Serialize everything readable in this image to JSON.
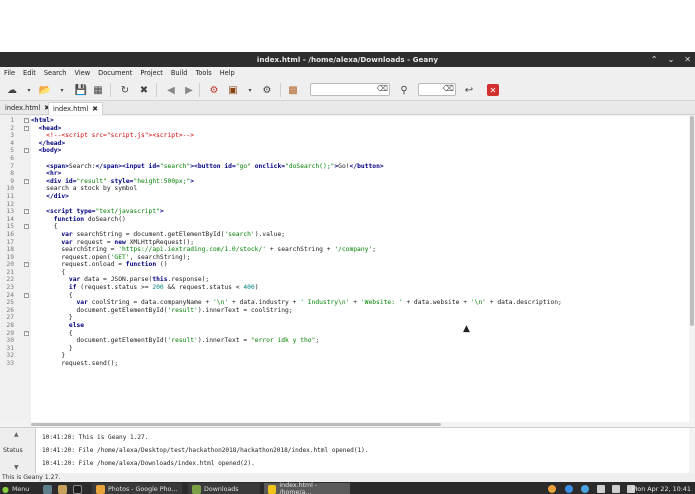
{
  "window": {
    "title": "index.html - /home/alexa/Downloads - Geany"
  },
  "menu": [
    "File",
    "Edit",
    "Search",
    "View",
    "Document",
    "Project",
    "Build",
    "Tools",
    "Help"
  ],
  "tabs": [
    {
      "label": "index.html",
      "active": false
    },
    {
      "label": "index.html",
      "active": true
    }
  ],
  "code_lines": [
    {
      "n": "1",
      "fold": "-",
      "parts": [
        [
          "tag",
          "<html>"
        ]
      ]
    },
    {
      "n": "2",
      "fold": "-",
      "parts": [
        [
          "plain",
          "  "
        ],
        [
          "tag",
          "<head>"
        ]
      ]
    },
    {
      "n": "3",
      "fold": "",
      "parts": [
        [
          "cmt",
          "    <!--<script src=\"script.js\"><script>-->"
        ]
      ]
    },
    {
      "n": "4",
      "fold": "",
      "parts": [
        [
          "plain",
          "  "
        ],
        [
          "tag",
          "</head>"
        ]
      ]
    },
    {
      "n": "5",
      "fold": "-",
      "parts": [
        [
          "plain",
          "  "
        ],
        [
          "tag",
          "<body>"
        ]
      ]
    },
    {
      "n": "6",
      "fold": "",
      "parts": []
    },
    {
      "n": "7",
      "fold": "",
      "parts": [
        [
          "plain",
          "    "
        ],
        [
          "tag",
          "<span>"
        ],
        [
          "plain",
          "Search:"
        ],
        [
          "tag",
          "</span><input id="
        ],
        [
          "str",
          "\"search\""
        ],
        [
          "tag",
          "><button id="
        ],
        [
          "str",
          "\"go\""
        ],
        [
          "tag",
          " onclick="
        ],
        [
          "str",
          "\"doSearch();\""
        ],
        [
          "tag",
          ">"
        ],
        [
          "plain",
          "Go!"
        ],
        [
          "tag",
          "</button>"
        ]
      ]
    },
    {
      "n": "8",
      "fold": "",
      "parts": [
        [
          "plain",
          "    "
        ],
        [
          "tag",
          "<hr>"
        ]
      ]
    },
    {
      "n": "9",
      "fold": "-",
      "parts": [
        [
          "plain",
          "    "
        ],
        [
          "tag",
          "<div id="
        ],
        [
          "str",
          "\"result\""
        ],
        [
          "tag",
          " style="
        ],
        [
          "str",
          "\"height:500px;\""
        ],
        [
          "tag",
          ">"
        ]
      ]
    },
    {
      "n": "10",
      "fold": "",
      "parts": [
        [
          "plain",
          "    search a stock by symbol"
        ]
      ]
    },
    {
      "n": "11",
      "fold": "",
      "parts": [
        [
          "plain",
          "    "
        ],
        [
          "tag",
          "</div>"
        ]
      ]
    },
    {
      "n": "12",
      "fold": "",
      "parts": []
    },
    {
      "n": "13",
      "fold": "-",
      "parts": [
        [
          "plain",
          "    "
        ],
        [
          "tag",
          "<script type="
        ],
        [
          "str",
          "\"text/javascript\""
        ],
        [
          "tag",
          ">"
        ]
      ]
    },
    {
      "n": "14",
      "fold": "",
      "parts": [
        [
          "plain",
          "      "
        ],
        [
          "kw",
          "function"
        ],
        [
          "plain",
          " doSearch()"
        ]
      ]
    },
    {
      "n": "15",
      "fold": "-",
      "parts": [
        [
          "plain",
          "      {"
        ]
      ]
    },
    {
      "n": "16",
      "fold": "",
      "parts": [
        [
          "plain",
          "        "
        ],
        [
          "kw",
          "var"
        ],
        [
          "plain",
          " searchString = document.getElementById("
        ],
        [
          "str",
          "'search'"
        ],
        [
          "plain",
          ").value;"
        ]
      ]
    },
    {
      "n": "17",
      "fold": "",
      "parts": [
        [
          "plain",
          "        "
        ],
        [
          "kw",
          "var"
        ],
        [
          "plain",
          " request = "
        ],
        [
          "kw",
          "new"
        ],
        [
          "plain",
          " XMLHttpRequest();"
        ]
      ]
    },
    {
      "n": "18",
      "fold": "",
      "parts": [
        [
          "plain",
          "        searchString = "
        ],
        [
          "str",
          "'https://api.iextrading.com/1.0/stock/'"
        ],
        [
          "plain",
          " + searchString + "
        ],
        [
          "str",
          "'/company'"
        ],
        [
          "plain",
          ";"
        ]
      ]
    },
    {
      "n": "19",
      "fold": "",
      "parts": [
        [
          "plain",
          "        request.open("
        ],
        [
          "str",
          "'GET'"
        ],
        [
          "plain",
          ", searchString);"
        ]
      ]
    },
    {
      "n": "20",
      "fold": "-",
      "parts": [
        [
          "plain",
          "        request.onload = "
        ],
        [
          "kw",
          "function"
        ],
        [
          "plain",
          " ()"
        ]
      ]
    },
    {
      "n": "21",
      "fold": "",
      "parts": [
        [
          "plain",
          "        {"
        ]
      ]
    },
    {
      "n": "22",
      "fold": "",
      "parts": [
        [
          "plain",
          "          "
        ],
        [
          "kw",
          "var"
        ],
        [
          "plain",
          " data = JSON.parse("
        ],
        [
          "kw",
          "this"
        ],
        [
          "plain",
          ".response);"
        ]
      ]
    },
    {
      "n": "23",
      "fold": "",
      "parts": [
        [
          "plain",
          "          "
        ],
        [
          "kw",
          "if"
        ],
        [
          "plain",
          " (request.status >= "
        ],
        [
          "num",
          "200"
        ],
        [
          "plain",
          " && request.status < "
        ],
        [
          "num",
          "400"
        ],
        [
          "plain",
          ")"
        ]
      ]
    },
    {
      "n": "24",
      "fold": "-",
      "parts": [
        [
          "plain",
          "          {"
        ]
      ]
    },
    {
      "n": "25",
      "fold": "",
      "parts": [
        [
          "plain",
          "            "
        ],
        [
          "kw",
          "var"
        ],
        [
          "plain",
          " coolString = data.companyName + "
        ],
        [
          "str",
          "'\\n'"
        ],
        [
          "plain",
          " + data.industry + "
        ],
        [
          "str",
          "' Industry\\n'"
        ],
        [
          "plain",
          " + "
        ],
        [
          "str",
          "'Website: '"
        ],
        [
          "plain",
          " + data.website + "
        ],
        [
          "str",
          "'\\n'"
        ],
        [
          "plain",
          " + data.description;"
        ]
      ]
    },
    {
      "n": "26",
      "fold": "",
      "parts": [
        [
          "plain",
          "            document.getElementById("
        ],
        [
          "str",
          "'result'"
        ],
        [
          "plain",
          ").innerText = coolString;"
        ]
      ]
    },
    {
      "n": "27",
      "fold": "",
      "parts": [
        [
          "plain",
          "          }"
        ]
      ]
    },
    {
      "n": "28",
      "fold": "",
      "parts": [
        [
          "plain",
          "          "
        ],
        [
          "kw",
          "else"
        ]
      ]
    },
    {
      "n": "29",
      "fold": "-",
      "parts": [
        [
          "plain",
          "          {"
        ]
      ]
    },
    {
      "n": "30",
      "fold": "",
      "parts": [
        [
          "plain",
          "            document.getElementById("
        ],
        [
          "str",
          "'result'"
        ],
        [
          "plain",
          ").innerText = "
        ],
        [
          "str",
          "\"error idk y tho\""
        ],
        [
          "plain",
          ";"
        ]
      ]
    },
    {
      "n": "31",
      "fold": "",
      "parts": [
        [
          "plain",
          "          }"
        ]
      ]
    },
    {
      "n": "32",
      "fold": "",
      "parts": [
        [
          "plain",
          "        }"
        ]
      ]
    },
    {
      "n": "33",
      "fold": "",
      "parts": [
        [
          "plain",
          "        request.send();"
        ]
      ]
    }
  ],
  "messages": {
    "tab_label": "Status",
    "lines": [
      "10:41:20: This is Geany 1.27.",
      "10:41:20: File /home/alexa/Desktop/test/hackathon2018/hackathon2018/index.html opened(1).",
      "10:41:20: File /home/alexa/Downloads/index.html opened(2)."
    ]
  },
  "statusbar": {
    "text": "This is Geany 1.27."
  },
  "taskbar": {
    "menu_label": "Menu",
    "apps": [
      {
        "label": "Photos - Google Pho...",
        "icon_color": "#e8a33b",
        "active": false
      },
      {
        "label": "Downloads",
        "icon_color": "#7aa146",
        "active": false
      },
      {
        "label": "index.html - /home/a...",
        "icon_color": "#f0c419",
        "active": true
      }
    ],
    "clock": "Mon Apr 22, 10:41"
  }
}
